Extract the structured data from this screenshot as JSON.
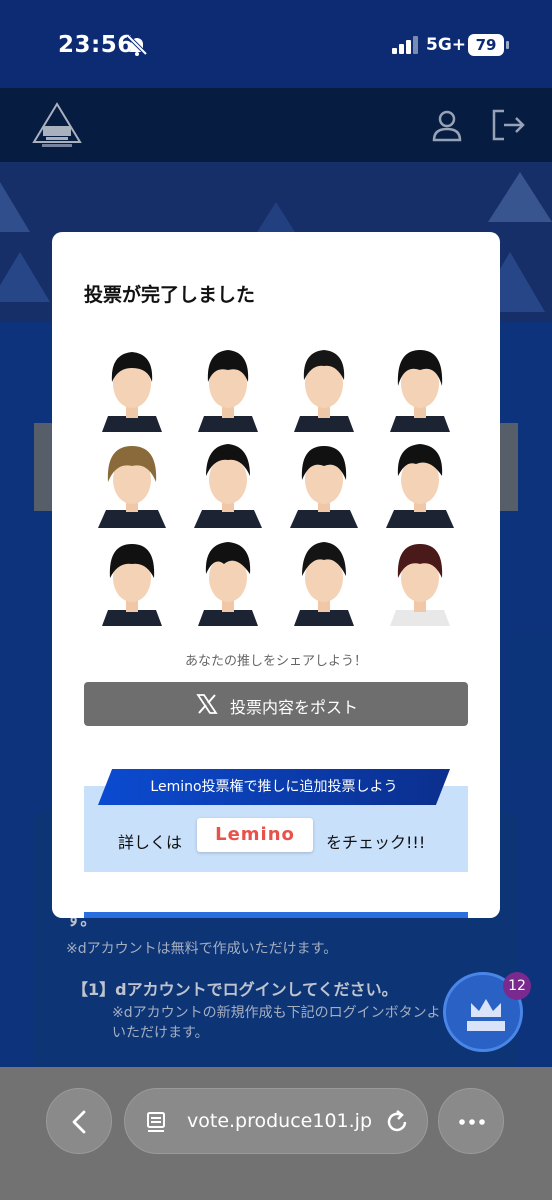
{
  "status_bar": {
    "time": "23:56",
    "network": "5G+",
    "battery": "79"
  },
  "modal": {
    "title": "投票が完了しました",
    "share_prompt": "あなたの推しをシェアしよう！",
    "post_button_label": "投票内容をポスト",
    "lemino": {
      "banner": "Lemino投票権で推しに追加投票しよう",
      "left_text": "詳しくは",
      "logo_text": "Lemino",
      "right_text": "をチェック!!!"
    }
  },
  "background_page": {
    "line1": "す。",
    "line2": "※dアカウントは無料で作成いただけます。",
    "step1": "【1】dアカウントでログインしてください。",
    "step1_note": "※dアカウントの新規作成も下記のログインボタンより",
    "step1_note2": "いただけます。"
  },
  "fab": {
    "badge_count": "12"
  },
  "browser": {
    "url": "vote.produce101.jp"
  },
  "colors": {
    "brand_navy": "#0d2b72",
    "accent_blue": "#0b4bd1",
    "lemino_bg": "#c8e0fa"
  }
}
